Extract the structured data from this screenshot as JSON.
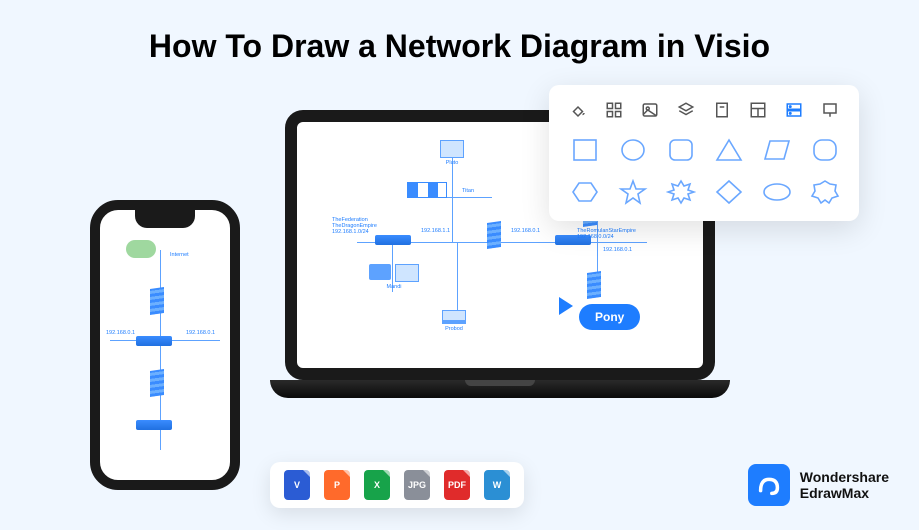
{
  "title": "How To Draw a Network Diagram in Visio",
  "toolbar": {
    "icons": [
      "fill",
      "apps",
      "image",
      "layers",
      "page",
      "layout",
      "storage",
      "pin"
    ],
    "active_index": 6
  },
  "diagram": {
    "pony_label": "Pony",
    "nodes": {
      "cloud": "Internet",
      "pc_top": "Pluto",
      "titan": "Titan",
      "federation": "TheFederation\nTheDragonEmpire\n192.168.1.0/24",
      "ip_left": "192.168.1.1",
      "ip_mid": "192.168.0.1",
      "mandi": "Mandi",
      "probod": "Probod",
      "romulan": "TheRomulanStarEmpire\n192.168.0.0/24",
      "ip_right": "192.168.0.1",
      "phone_ip": "192.168.0.1"
    }
  },
  "files": [
    {
      "label": "V",
      "color": "#2b5cd4"
    },
    {
      "label": "P",
      "color": "#ff6a2b"
    },
    {
      "label": "X",
      "color": "#17a34a"
    },
    {
      "label": "JPG",
      "color": "#8a8f99"
    },
    {
      "label": "PDF",
      "color": "#e02b2b"
    },
    {
      "label": "W",
      "color": "#2b8fd4"
    }
  ],
  "brand": {
    "line1": "Wondershare",
    "line2": "EdrawMax"
  }
}
